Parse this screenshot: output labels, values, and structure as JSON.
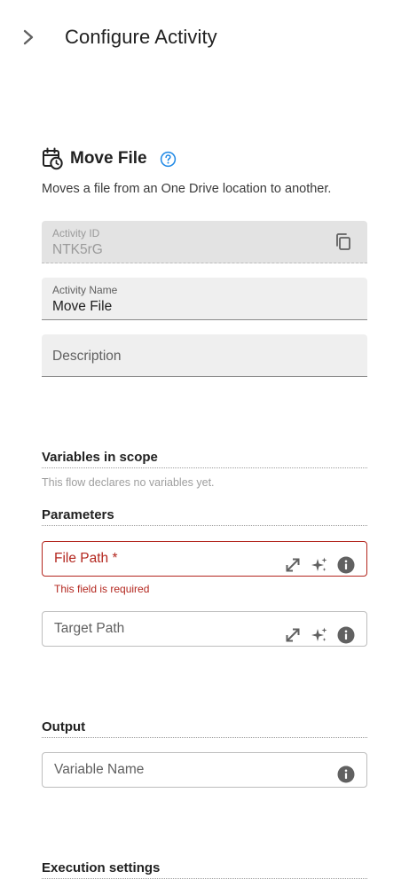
{
  "header": {
    "title": "Configure Activity",
    "collapse_icon": "chevron-right-icon"
  },
  "activity": {
    "icon": "calendar-clock-icon",
    "title": "Move File",
    "help_icon": "help-circle-icon",
    "description": "Moves a file from an One Drive location to another."
  },
  "fields": {
    "activity_id": {
      "label": "Activity ID",
      "value": "NTK5rG",
      "copy_icon": "copy-icon"
    },
    "activity_name": {
      "label": "Activity Name",
      "value": "Move File"
    },
    "description": {
      "placeholder": "Description"
    }
  },
  "variables": {
    "title": "Variables in scope",
    "note": "This flow declares no variables yet."
  },
  "parameters": {
    "title": "Parameters",
    "file_path": {
      "label": "File Path *",
      "error": "This field is required"
    },
    "target_path": {
      "label": "Target Path"
    }
  },
  "output": {
    "title": "Output",
    "variable_name": {
      "label": "Variable Name"
    }
  },
  "execution": {
    "title": "Execution settings"
  },
  "colors": {
    "error": "#b3261e",
    "accent": "#1e88e5",
    "text": "#212121",
    "field_bg": "#efefef"
  }
}
